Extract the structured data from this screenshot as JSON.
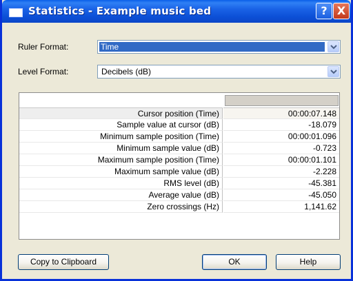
{
  "window": {
    "title": "Statistics - Example music bed",
    "help_glyph": "?",
    "close_glyph": "X"
  },
  "ruler_format": {
    "label": "Ruler Format:",
    "value": "Time"
  },
  "level_format": {
    "label": "Level Format:",
    "value": "Decibels (dB)"
  },
  "stats": {
    "rows": [
      {
        "name": "Cursor position (Time)",
        "value": "00:00:07.148"
      },
      {
        "name": "Sample value at cursor (dB)",
        "value": "-18.079"
      },
      {
        "name": "Minimum sample position (Time)",
        "value": "00:00:01.096"
      },
      {
        "name": "Minimum sample value (dB)",
        "value": "-0.723"
      },
      {
        "name": "Maximum sample position (Time)",
        "value": "00:00:01.101"
      },
      {
        "name": "Maximum sample value (dB)",
        "value": "-2.228"
      },
      {
        "name": "RMS level (dB)",
        "value": "-45.381"
      },
      {
        "name": "Average value (dB)",
        "value": "-45.050"
      },
      {
        "name": "Zero crossings (Hz)",
        "value": "1,141.62"
      }
    ]
  },
  "buttons": {
    "copy": "Copy to Clipboard",
    "ok": "OK",
    "help": "Help"
  },
  "icons": {
    "title_icon": "window-icon",
    "dropdown": "chevron-down-icon"
  },
  "colors": {
    "titlebar": "#0b4fd6",
    "selection": "#316ac5",
    "dialog_bg": "#ece9d8"
  }
}
